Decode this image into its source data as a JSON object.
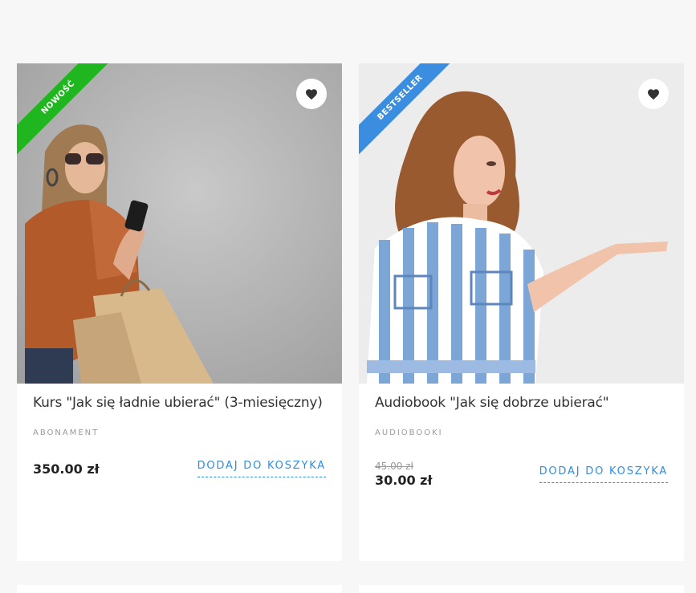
{
  "products": [
    {
      "badge": "NOWOŚĆ",
      "title": "Kurs \"Jak się ładnie ubierać\" (3-miesięczny)",
      "category": "ABONAMENT",
      "price": "350.00 zł",
      "add_to_cart": "DODAJ DO KOSZYKA"
    },
    {
      "badge": "BESTSELLER",
      "title": "Audiobook \"Jak się dobrze ubierać\"",
      "category": "AUDIOBOOKI",
      "old_price": "45.00 zł",
      "price": "30.00 zł",
      "add_to_cart": "DODAJ DO KOSZYKA"
    }
  ],
  "icons": {
    "wishlist": "heart-icon"
  },
  "colors": {
    "badge_new": "#1fb61f",
    "badge_bestseller": "#3b8de0",
    "link": "#2f8de4"
  }
}
